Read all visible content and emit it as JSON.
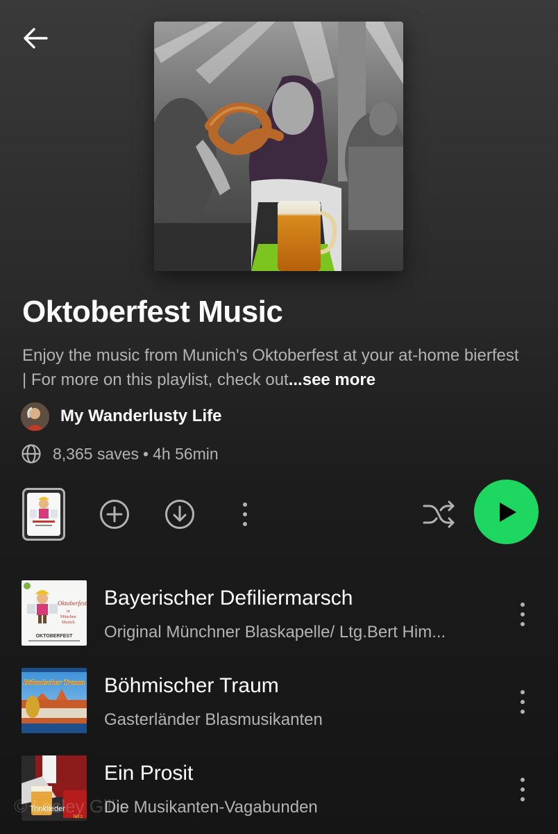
{
  "header": {
    "back_icon": "arrow-left-icon"
  },
  "playlist": {
    "title": "Oktoberfest Music",
    "description": "Enjoy the music from Munich's Oktoberfest at your at-home bierfest | For more on this playlist, check out",
    "see_more": "...see more",
    "owner": "My Wanderlusty Life",
    "saves": "8,365 saves",
    "separator": "•",
    "duration": "4h 56min"
  },
  "actions": {
    "add_icon": "plus-circle-icon",
    "download_icon": "download-circle-icon",
    "more_icon": "more-vertical-icon",
    "shuffle_icon": "shuffle-icon",
    "play_icon": "play-icon",
    "accent": "#1ed760"
  },
  "tracks": [
    {
      "title": "Bayerischer Defiliermarsch",
      "artist": "Original Münchner Blaskapelle/ Ltg.Bert Him..."
    },
    {
      "title": "Böhmischer Traum",
      "artist": "Gasterländer Blasmusikanten"
    },
    {
      "title": "Ein Prosit",
      "artist": "Die Musikanten-Vagabunden"
    }
  ],
  "art_text": {
    "album1_title": "Oktoberfest",
    "album1_sub1": "in",
    "album1_sub2": "München",
    "album1_sub3": "Munich",
    "album1_bottom": "OKTOBERFEST",
    "album2_title": "Böhmischer Traum",
    "album3_label": "Trinklieder",
    "album3_sub": "Teil 2"
  },
  "watermark": "© Lesley Gillis"
}
